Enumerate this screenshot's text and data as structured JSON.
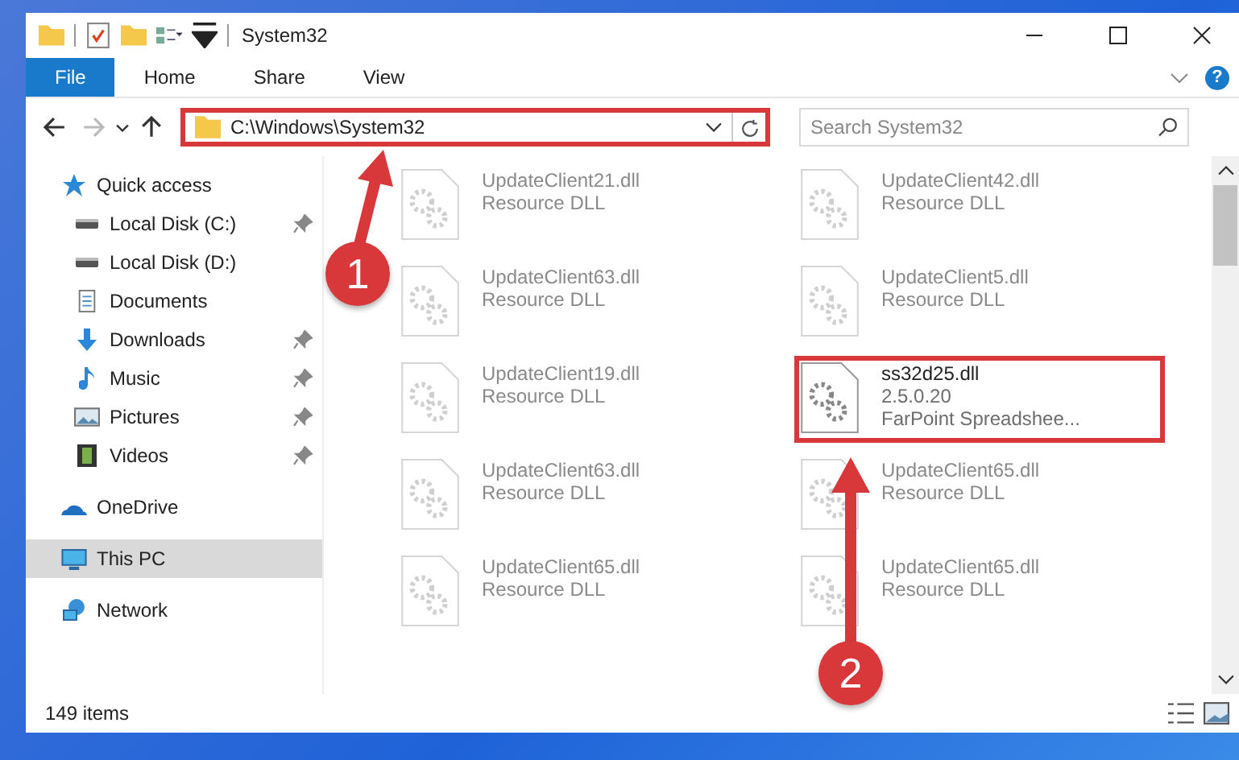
{
  "window": {
    "title": "System32"
  },
  "ribbon": {
    "tabs": [
      {
        "label": "File",
        "selected": true
      },
      {
        "label": "Home",
        "selected": false
      },
      {
        "label": "Share",
        "selected": false
      },
      {
        "label": "View",
        "selected": false
      }
    ],
    "help": "?"
  },
  "address_bar": {
    "path": "C:\\Windows\\System32",
    "highlighted": true
  },
  "search": {
    "placeholder": "Search System32"
  },
  "sidebar": {
    "items": [
      {
        "label": "Quick access",
        "kind": "star",
        "selected": false,
        "children": [
          {
            "label": "Local Disk (C:)",
            "kind": "disk",
            "pinned": true
          },
          {
            "label": "Local Disk (D:)",
            "kind": "disk",
            "pinned": false
          },
          {
            "label": "Documents",
            "kind": "documents",
            "pinned": false
          },
          {
            "label": "Downloads",
            "kind": "download",
            "pinned": true
          },
          {
            "label": "Music",
            "kind": "music",
            "pinned": true
          },
          {
            "label": "Pictures",
            "kind": "pictures",
            "pinned": true
          },
          {
            "label": "Videos",
            "kind": "videos",
            "pinned": true
          }
        ]
      },
      {
        "label": "OneDrive",
        "kind": "cloud",
        "selected": false
      },
      {
        "label": "This PC",
        "kind": "pc",
        "selected": true
      },
      {
        "label": "Network",
        "kind": "network",
        "selected": false
      }
    ]
  },
  "files": [
    {
      "name": "UpdateClient21.dll",
      "details": [
        "Resource DLL"
      ],
      "faded": true,
      "highlighted": false
    },
    {
      "name": "UpdateClient42.dll",
      "details": [
        "Resource DLL"
      ],
      "faded": true,
      "highlighted": false
    },
    {
      "name": "UpdateClient63.dll",
      "details": [
        "Resource DLL"
      ],
      "faded": true,
      "highlighted": false
    },
    {
      "name": "UpdateClient5.dll",
      "details": [
        "Resource DLL"
      ],
      "faded": true,
      "highlighted": false
    },
    {
      "name": "UpdateClient19.dll",
      "details": [
        "Resource DLL"
      ],
      "faded": true,
      "highlighted": false
    },
    {
      "name": "ss32d25.dll",
      "details": [
        "2.5.0.20",
        "FarPoint Spreadshee..."
      ],
      "faded": false,
      "highlighted": true
    },
    {
      "name": "UpdateClient63.dll",
      "details": [
        "Resource DLL"
      ],
      "faded": true,
      "highlighted": false
    },
    {
      "name": "UpdateClient65.dll",
      "details": [
        "Resource DLL"
      ],
      "faded": true,
      "highlighted": false
    },
    {
      "name": "UpdateClient65.dll",
      "details": [
        "Resource DLL"
      ],
      "faded": true,
      "highlighted": false
    },
    {
      "name": "UpdateClient65.dll",
      "details": [
        "Resource DLL"
      ],
      "faded": true,
      "highlighted": false
    }
  ],
  "status_bar": {
    "count": "149 items"
  },
  "annotations": [
    {
      "label": "1"
    },
    {
      "label": "2"
    }
  ]
}
